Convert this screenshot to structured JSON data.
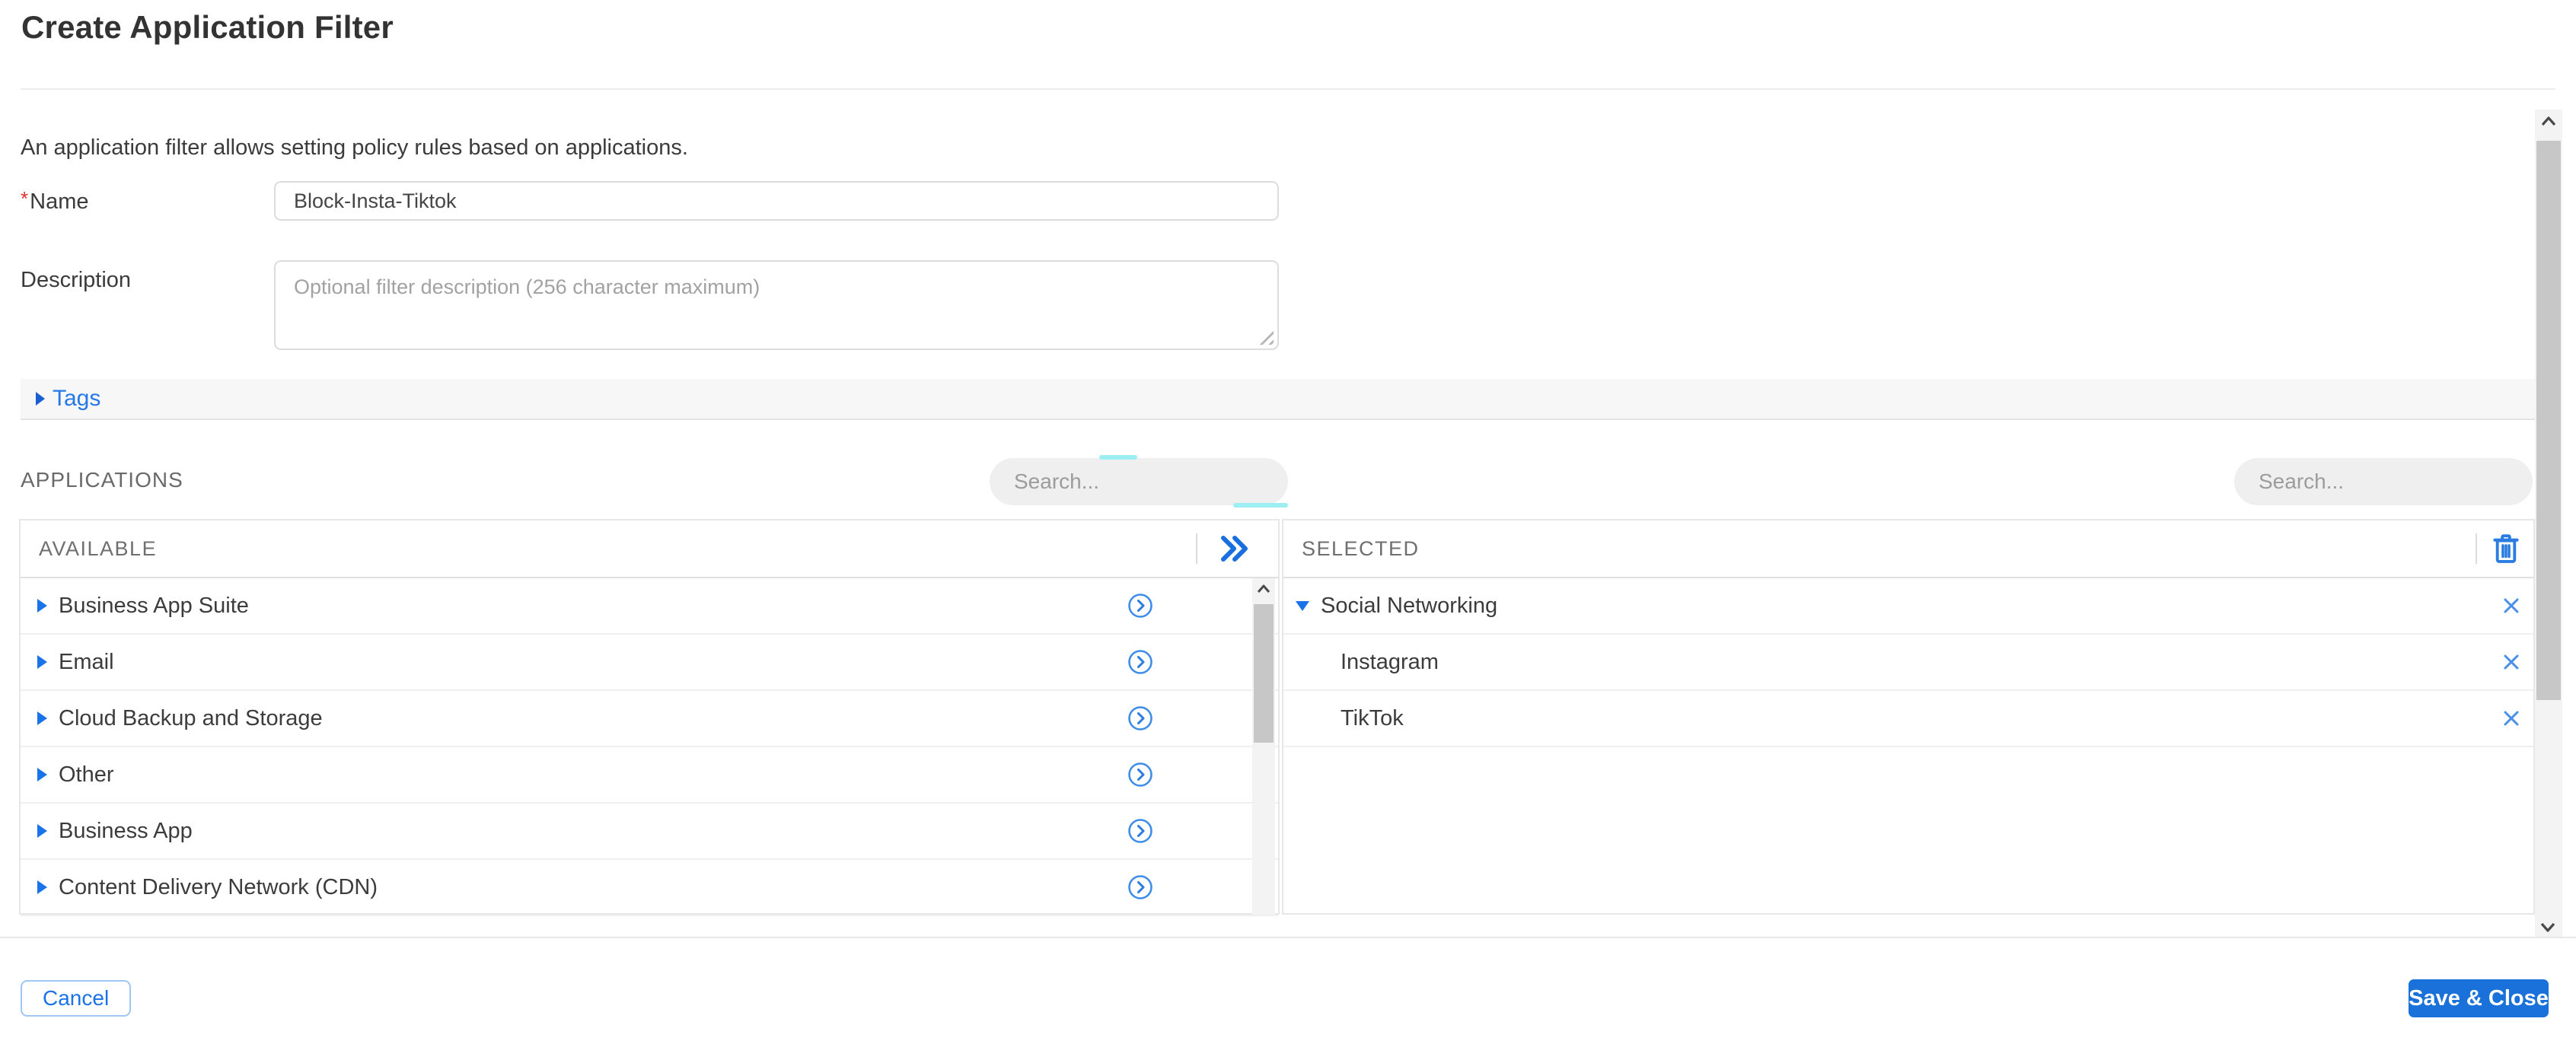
{
  "page": {
    "title": "Create Application Filter",
    "intro": "An application filter allows setting policy rules based on applications."
  },
  "form": {
    "required_marker": "*",
    "name_label": "Name",
    "name_value": "Block-Insta-Tiktok",
    "description_label": "Description",
    "description_placeholder": "Optional filter description (256 character maximum)",
    "tags_label": "Tags"
  },
  "applications": {
    "section_label": "APPLICATIONS",
    "available_search_placeholder": "Search...",
    "selected_search_placeholder": "Search...",
    "available": {
      "header": "AVAILABLE",
      "move_all_icon": "double-chevron-right-icon",
      "items": [
        "Business App Suite",
        "Email",
        "Cloud Backup and Storage",
        "Other",
        "Business App",
        "Content Delivery Network (CDN)"
      ]
    },
    "selected": {
      "header": "SELECTED",
      "clear_all_icon": "trash-icon",
      "groups": [
        {
          "label": "Social Networking",
          "expanded": true,
          "children": [
            "Instagram",
            "TikTok"
          ]
        }
      ]
    }
  },
  "footer": {
    "cancel_label": "Cancel",
    "save_label": "Save & Close"
  },
  "colors": {
    "accent": "#1a73e8",
    "icon_blue": "#3f8de8",
    "save_button_bg": "#1971d9",
    "cancel_border": "#9ec7f4",
    "tags_link": "#2478e8",
    "header_gray": "#6f6f6f",
    "row_text": "#3c3c3c",
    "placeholder_gray": "#9c9c9c",
    "scrollbar_thumb": "#c7c7c7",
    "required_red": "#e03131"
  }
}
